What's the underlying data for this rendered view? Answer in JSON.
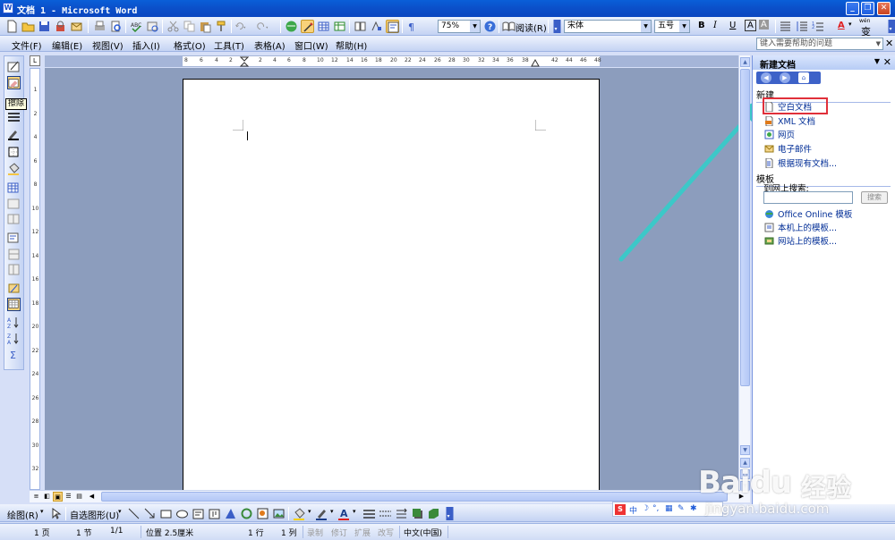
{
  "window": {
    "title": "文档 1 - Microsoft Word",
    "colors": {
      "titlebar": "#0a4fc9",
      "annotation_arrow": "#3cc8c8",
      "highlight_box": "#e0303a"
    }
  },
  "toolbar": {
    "zoom": "75%",
    "read_label": "阅读(R)",
    "font_name": "宋体",
    "font_size": "五号",
    "bold": "B",
    "italic": "I",
    "underline": "U",
    "char_border": "A",
    "char_shading": "A",
    "font_color": "A",
    "phonetic": "wén",
    "phonetic_char": "变"
  },
  "menubar": {
    "items": [
      "文件(F)",
      "编辑(E)",
      "视图(V)",
      "插入(I)",
      "格式(O)",
      "工具(T)",
      "表格(A)",
      "窗口(W)",
      "帮助(H)"
    ],
    "help_placeholder": "键入需要帮助的问题"
  },
  "tooltip": "擦除",
  "ruler": {
    "corner": "L",
    "h_numbers": [
      "8",
      "6",
      "4",
      "2",
      "2",
      "4",
      "6",
      "8",
      "10",
      "12",
      "14",
      "16",
      "18",
      "20",
      "22",
      "24",
      "26",
      "28",
      "30",
      "32",
      "34",
      "36",
      "38",
      "42",
      "44",
      "46",
      "48"
    ],
    "v_numbers": [
      "1",
      "2",
      "4",
      "6",
      "8",
      "10",
      "12",
      "14",
      "16",
      "18",
      "20",
      "22",
      "24",
      "26",
      "28",
      "30",
      "32"
    ]
  },
  "taskpane": {
    "title": "新建文档",
    "nav": [
      "◀",
      "▶",
      "⌂"
    ],
    "section_new": "新建",
    "new_items": [
      "空白文档",
      "XML 文档",
      "网页",
      "电子邮件",
      "根据现有文档..."
    ],
    "section_templates": "模板",
    "search_label": "到网上搜索:",
    "search_button": "搜索",
    "template_items": [
      "Office Online 模板",
      "本机上的模板...",
      "网站上的模板..."
    ]
  },
  "drawing_toolbar": {
    "draw": "绘图(R)",
    "autoshapes": "自选图形(U)"
  },
  "statusbar": {
    "page": "1 页",
    "section": "1 节",
    "page_count": "1/1",
    "position": "位置 2.5厘米",
    "line": "1 行",
    "column": "1 列",
    "rec": "录制",
    "trk": "修订",
    "ext": "扩展",
    "ovr": "改写",
    "language": "中文(中国)"
  },
  "ime": {
    "logo": "S",
    "mode": "中",
    "moon": "☽",
    "punct": "°,"
  },
  "watermark": {
    "brand": "Baidu",
    "suffix": "经验",
    "url": "jingyan.baidu.com"
  }
}
